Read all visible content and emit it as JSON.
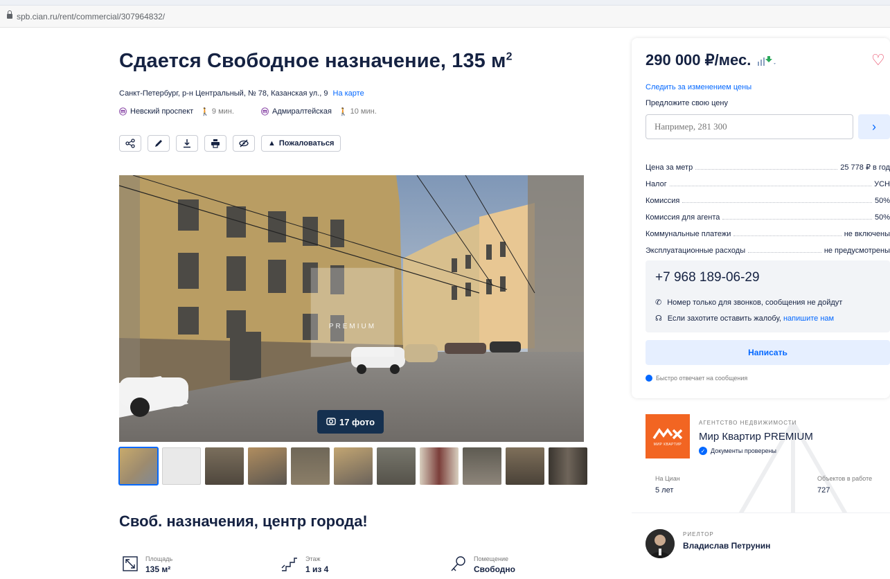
{
  "browser": {
    "url": "spb.cian.ru/rent/commercial/307964832/"
  },
  "listing": {
    "title": "Сдается Свободное назначение, 135 м",
    "title_sup": "2",
    "address": "Санкт-Петербург, р-н Центральный, № 78, Казанская ул., 9",
    "map_link": "На карте",
    "metro": [
      {
        "station": "Невский проспект",
        "walk": "9 мин."
      },
      {
        "station": "Адмиралтейская",
        "walk": "10 мин."
      }
    ],
    "complain_label": "Пожаловаться",
    "photo_count_label": "17 фото",
    "photo_watermark": "PREMIUM",
    "subtitle": "Своб. назначения, центр города!",
    "features": [
      {
        "label": "Площадь",
        "value": "135 м²"
      },
      {
        "label": "Этаж",
        "value": "1 из 4"
      },
      {
        "label": "Помещение",
        "value": "Свободно"
      }
    ]
  },
  "sidebar": {
    "price": "290 000 ₽/мес.",
    "follow_price": "Следить за изменением цены",
    "offer_label": "Предложите свою цену",
    "offer_placeholder": "Например, 281 300",
    "details": [
      {
        "label": "Цена за метр",
        "value": "25 778 ₽ в год"
      },
      {
        "label": "Налог",
        "value": "УСН"
      },
      {
        "label": "Комиссия",
        "value": "50%"
      },
      {
        "label": "Комиссия для агента",
        "value": "50%"
      },
      {
        "label": "Коммунальные платежи",
        "value": "не включены"
      },
      {
        "label": "Эксплуатационные расходы",
        "value": "не предусмотрены"
      }
    ],
    "phone": "+7 968 189-06-29",
    "phone_note": "Номер только для звонков, сообщения не дойдут",
    "complaint_note": "Если захотите оставить жалобу,",
    "complaint_link": "напишите нам",
    "write_button": "Написать",
    "fast_reply": "Быстро отвечает на сообщения"
  },
  "agency": {
    "type": "АГЕНТСТВО НЕДВИЖИМОСТИ",
    "name": "Мир Квартир PREMIUM",
    "verified": "Документы проверены",
    "logo_text": "МИР КВАРТИР",
    "on_cian_label": "На Циан",
    "on_cian_value": "5 лет",
    "objects_label": "Объектов в работе",
    "objects_value": "727"
  },
  "realtor": {
    "type": "РИЕЛТОР",
    "name": "Владислав Петрунин"
  },
  "colors": {
    "brand_blue": "#0468ff",
    "text_dark": "#152242",
    "metro_purple": "#7a2f9b",
    "heart_red": "#e84260",
    "agency_orange": "#f26522",
    "photo_badge": "#15304f"
  }
}
